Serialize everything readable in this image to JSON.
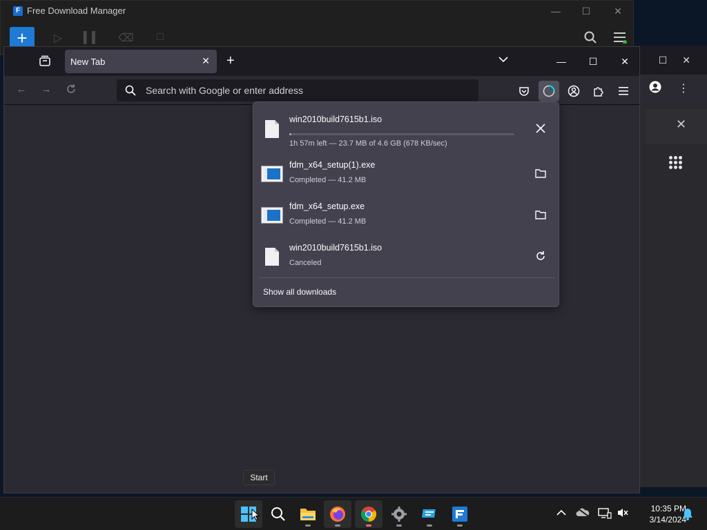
{
  "fdm": {
    "title": "Free Download Manager",
    "add_label": "+"
  },
  "firefox": {
    "tab_title": "New Tab",
    "search_placeholder": "Search with Google or enter address"
  },
  "downloads": {
    "items": [
      {
        "name": "win2010build7615b1.iso",
        "status": "1h 57m left — 23.7 MB of 4.6 GB (678 KB/sec)",
        "type": "iso",
        "progress": 0.005,
        "action": "cancel-icon"
      },
      {
        "name": "fdm_x64_setup(1).exe",
        "status": "Completed — 41.2 MB",
        "type": "exe",
        "action": "folder-icon"
      },
      {
        "name": "fdm_x64_setup.exe",
        "status": "Completed — 41.2 MB",
        "type": "exe",
        "action": "folder-icon"
      },
      {
        "name": "win2010build7615b1.iso",
        "status": "Canceled",
        "type": "iso",
        "action": "retry-icon"
      }
    ],
    "show_all": "Show all downloads"
  },
  "tooltip": "Start",
  "taskbar": {
    "time": "10:35 PM",
    "date": "3/14/2024"
  },
  "colors": {
    "accent": "#1f7ad6",
    "panel_bg": "#42414d",
    "toolbar_bg": "#2b2a33",
    "tabstrip_bg": "#1c1b22"
  }
}
